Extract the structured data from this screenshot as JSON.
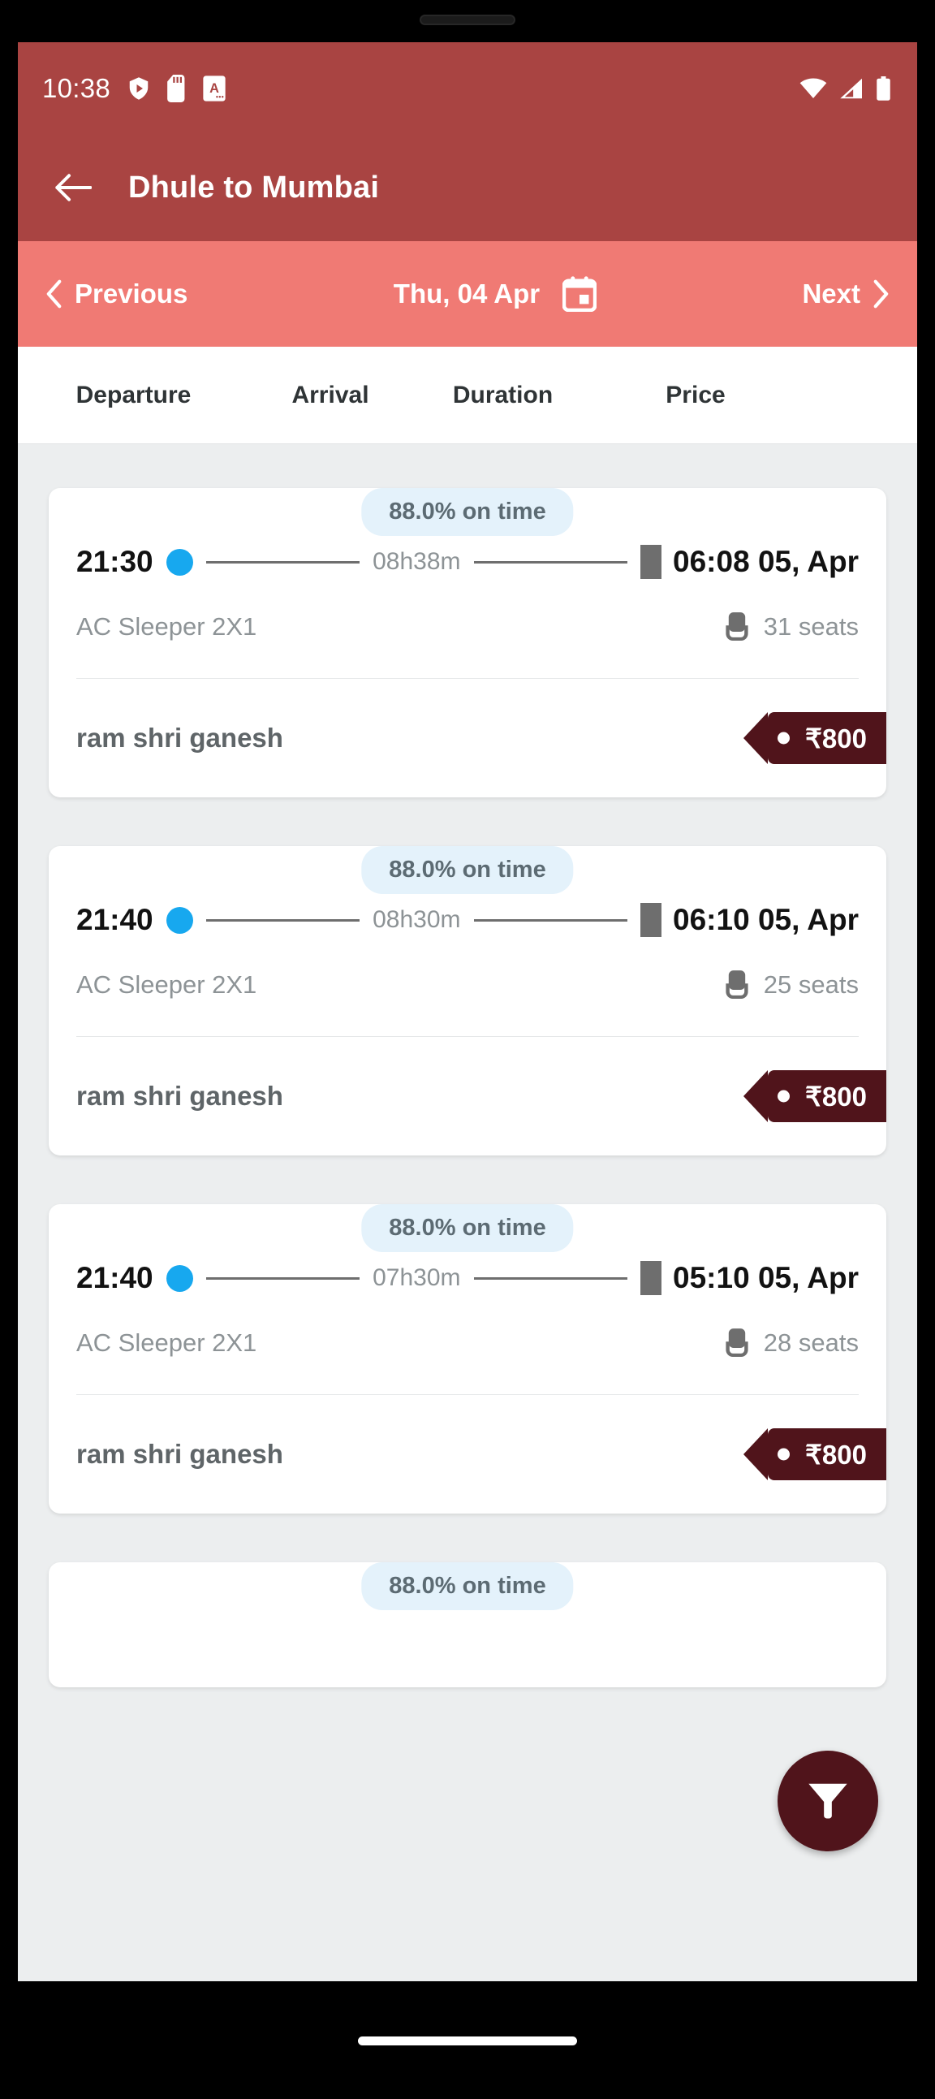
{
  "status_bar": {
    "time": "10:38",
    "left_icons": [
      "shield-play-icon",
      "sd-card-icon",
      "letter-a-icon"
    ],
    "right_icons": [
      "wifi-icon",
      "cellular-signal-icon",
      "battery-icon"
    ]
  },
  "app_bar": {
    "back_icon": "back-arrow-icon",
    "title": "Dhule to Mumbai"
  },
  "date_bar": {
    "previous_label": "Previous",
    "date_label": "Thu, 04 Apr",
    "next_label": "Next",
    "calendar_icon": "calendar-icon",
    "prev_icon": "chevron-left-icon",
    "next_icon": "chevron-right-icon"
  },
  "columns": {
    "departure": "Departure",
    "arrival": "Arrival",
    "duration": "Duration",
    "price": "Price"
  },
  "fab": {
    "icon": "filter-funnel-icon"
  },
  "colors": {
    "app_bar": "#a94442",
    "date_bar": "#f07a74",
    "accent_dark": "#50141b",
    "dot_blue": "#17a8ef",
    "badge_bg": "#e4f2fb",
    "page_bg": "#eceeef"
  },
  "buses": [
    {
      "on_time": "88.0% on time",
      "departure": "21:30",
      "duration": "08h38m",
      "arrival": "06:08 05, Apr",
      "bus_type": "AC Sleeper 2X1",
      "seats": "31 seats",
      "operator": "ram shri ganesh",
      "price": "₹800"
    },
    {
      "on_time": "88.0% on time",
      "departure": "21:40",
      "duration": "08h30m",
      "arrival": "06:10 05, Apr",
      "bus_type": "AC Sleeper 2X1",
      "seats": "25 seats",
      "operator": "ram shri ganesh",
      "price": "₹800"
    },
    {
      "on_time": "88.0% on time",
      "departure": "21:40",
      "duration": "07h30m",
      "arrival": "05:10 05, Apr",
      "bus_type": "AC Sleeper 2X1",
      "seats": "28 seats",
      "operator": "ram shri ganesh",
      "price": "₹800"
    },
    {
      "on_time": "88.0% on time",
      "departure": "",
      "duration": "",
      "arrival": "",
      "bus_type": "",
      "seats": "",
      "operator": "",
      "price": ""
    }
  ]
}
